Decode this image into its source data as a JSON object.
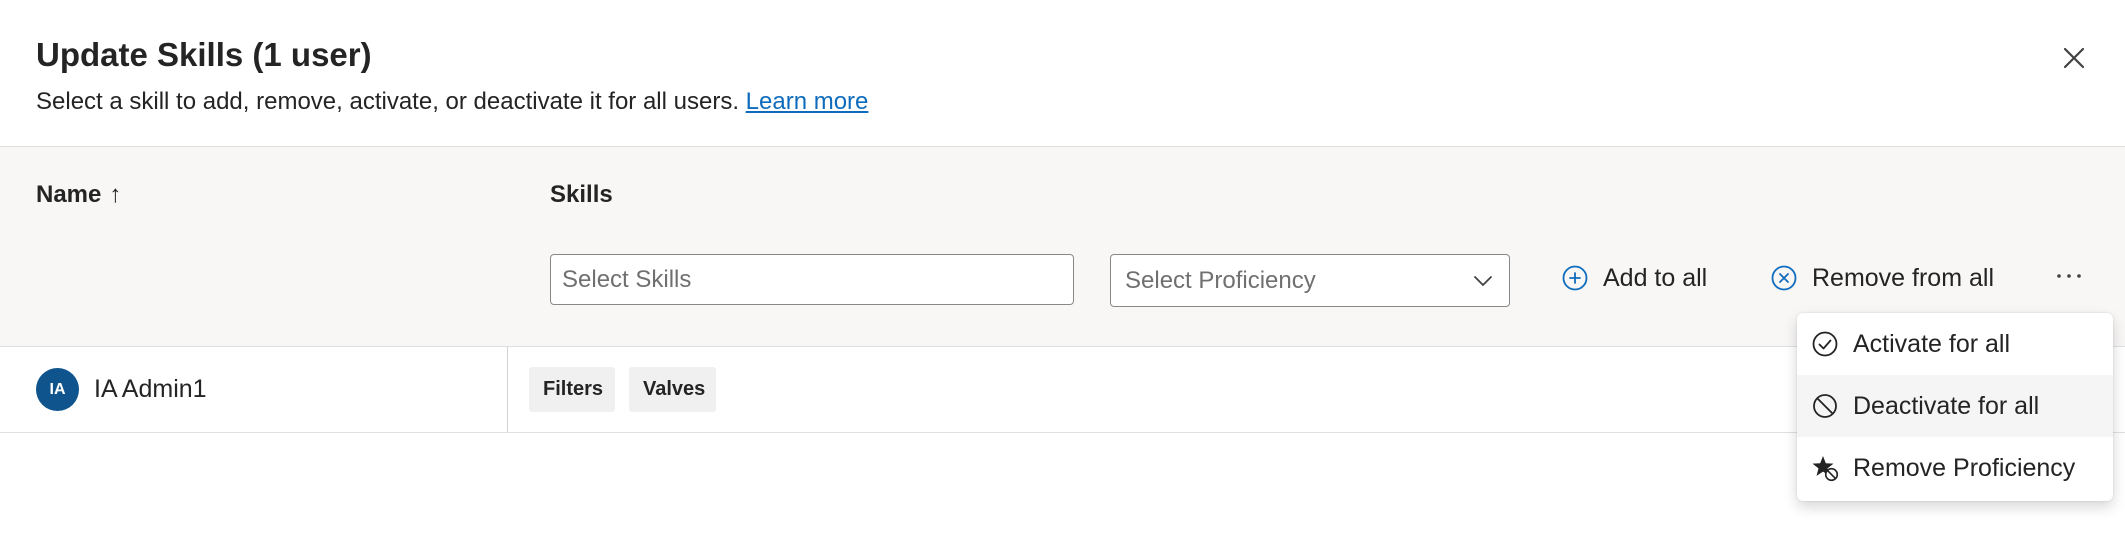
{
  "dialog": {
    "title": "Update Skills (1 user)",
    "subtitle": "Select a skill to add, remove, activate, or deactivate it for all users.",
    "learn_more": "Learn more"
  },
  "columns": {
    "name": "Name",
    "sort_indicator": "↑",
    "skills": "Skills"
  },
  "bulk": {
    "skills_placeholder": "Select Skills",
    "proficiency_placeholder": "Select Proficiency",
    "add_all": "Add to all",
    "remove_all": "Remove from all"
  },
  "users": [
    {
      "initials": "IA",
      "name": "IA Admin1",
      "skills": [
        "Filters",
        "Valves"
      ]
    }
  ],
  "menu": {
    "items": [
      {
        "label": "Activate for all",
        "icon": "checkmark-circle-icon"
      },
      {
        "label": "Deactivate for all",
        "icon": "prohibited-icon"
      },
      {
        "label": "Remove Proficiency",
        "icon": "star-prohibited-icon"
      }
    ]
  },
  "colors": {
    "accent": "#0f6cbd",
    "avatar": "#0f548c",
    "toolbar_bg": "#f8f7f6"
  }
}
